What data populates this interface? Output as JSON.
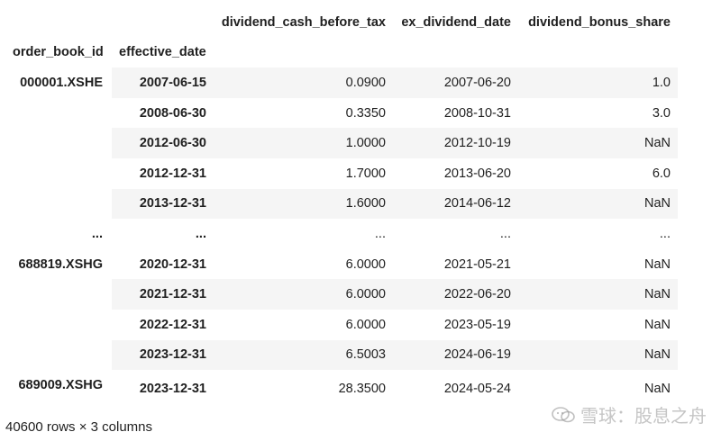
{
  "table": {
    "columns": [
      "dividend_cash_before_tax",
      "ex_dividend_date",
      "dividend_bonus_share"
    ],
    "index_names": [
      "order_book_id",
      "effective_date"
    ],
    "rows": [
      {
        "id": "000001.XSHE",
        "date": "2007-06-15",
        "cash": "0.0900",
        "exdate": "2007-06-20",
        "bonus": "1.0"
      },
      {
        "id": "",
        "date": "2008-06-30",
        "cash": "0.3350",
        "exdate": "2008-10-31",
        "bonus": "3.0"
      },
      {
        "id": "",
        "date": "2012-06-30",
        "cash": "1.0000",
        "exdate": "2012-10-19",
        "bonus": "NaN"
      },
      {
        "id": "",
        "date": "2012-12-31",
        "cash": "1.7000",
        "exdate": "2013-06-20",
        "bonus": "6.0"
      },
      {
        "id": "",
        "date": "2013-12-31",
        "cash": "1.6000",
        "exdate": "2014-06-12",
        "bonus": "NaN"
      },
      {
        "id": "...",
        "date": "...",
        "cash": "...",
        "exdate": "...",
        "bonus": "..."
      },
      {
        "id": "688819.XSHG",
        "date": "2020-12-31",
        "cash": "6.0000",
        "exdate": "2021-05-21",
        "bonus": "NaN"
      },
      {
        "id": "",
        "date": "2021-12-31",
        "cash": "6.0000",
        "exdate": "2022-06-20",
        "bonus": "NaN"
      },
      {
        "id": "",
        "date": "2022-12-31",
        "cash": "6.0000",
        "exdate": "2023-05-19",
        "bonus": "NaN"
      },
      {
        "id": "",
        "date": "2023-12-31",
        "cash": "6.5003",
        "exdate": "2024-06-19",
        "bonus": "NaN"
      },
      {
        "id": "689009.XSHG",
        "date": "2023-12-31",
        "cash": "28.3500",
        "exdate": "2024-05-24",
        "bonus": "NaN"
      }
    ]
  },
  "footer": "40600 rows × 3 columns",
  "watermark": {
    "text": "雪球：股息之舟",
    "icon": "snowball-logo-icon"
  },
  "colors": {
    "stripe": "#f5f5f5",
    "text": "#1f1f1f"
  }
}
